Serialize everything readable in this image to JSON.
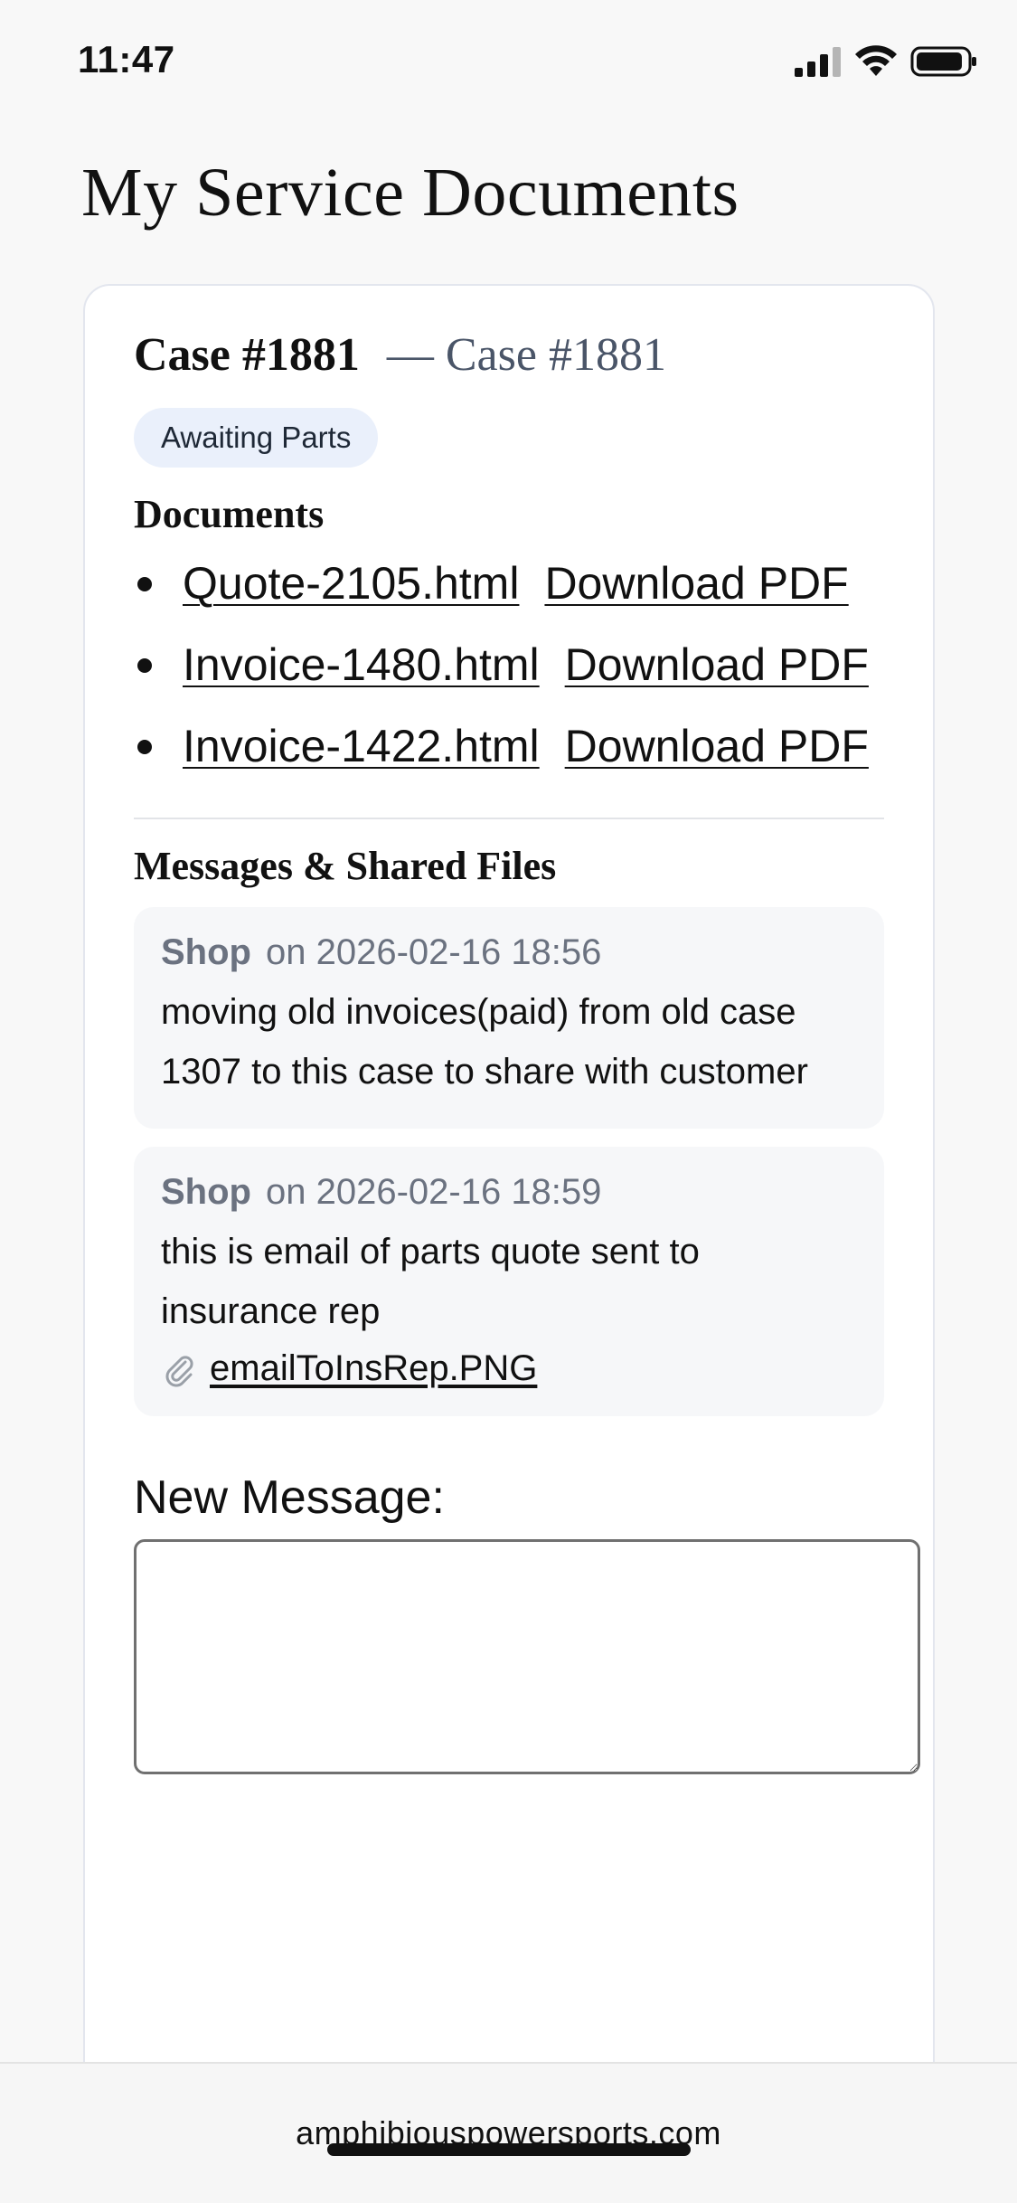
{
  "status_bar": {
    "time": "11:47"
  },
  "page": {
    "title": "My Service Documents"
  },
  "case": {
    "title": "Case #1881",
    "subtitle": "— Case #1881",
    "status": "Awaiting Parts",
    "documents_heading": "Documents",
    "documents": [
      {
        "name": "Quote-2105.html",
        "download_label": "Download PDF"
      },
      {
        "name": "Invoice-1480.html",
        "download_label": "Download PDF"
      },
      {
        "name": "Invoice-1422.html",
        "download_label": "Download PDF"
      }
    ],
    "messages_heading": "Messages & Shared Files",
    "messages": [
      {
        "author": "Shop",
        "timestamp": "on 2026-02-16 18:56",
        "body": "moving old invoices(paid) from old case 1307 to this case to share with customer"
      },
      {
        "author": "Shop",
        "timestamp": "on 2026-02-16 18:59",
        "body": "this is email of parts quote sent to insurance rep",
        "attachment": "emailToInsRep.PNG"
      }
    ],
    "new_message_label": "New Message:",
    "new_message_value": ""
  },
  "browser": {
    "url": "amphibiouspowersports.com"
  },
  "icons": {
    "signal": "signal-icon",
    "wifi": "wifi-icon",
    "battery": "battery-icon",
    "attachment": "paperclip-icon"
  }
}
